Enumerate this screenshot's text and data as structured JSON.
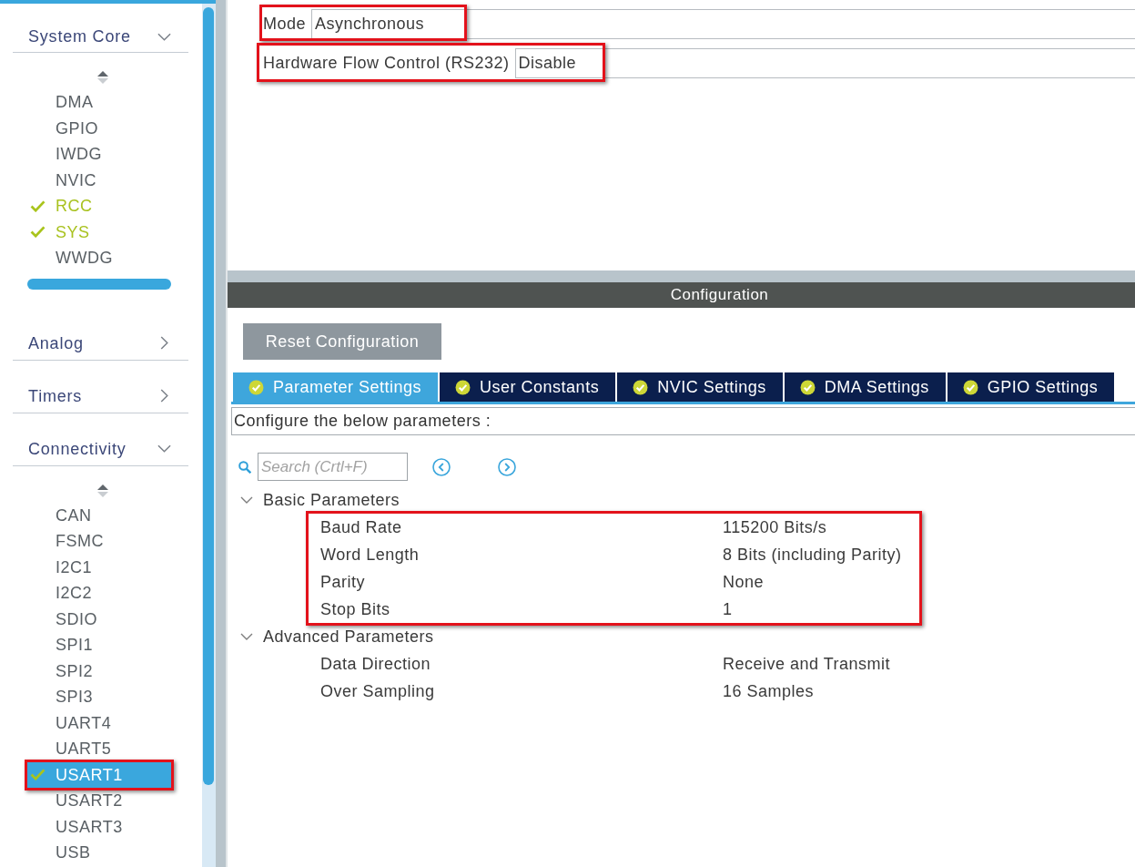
{
  "sidebar": {
    "categories": [
      {
        "title": "System Core",
        "expanded": true,
        "items": [
          {
            "label": "DMA",
            "checked": false,
            "selected": false,
            "highlighted": false
          },
          {
            "label": "GPIO",
            "checked": false,
            "selected": false,
            "highlighted": false
          },
          {
            "label": "IWDG",
            "checked": false,
            "selected": false,
            "highlighted": false
          },
          {
            "label": "NVIC",
            "checked": false,
            "selected": false,
            "highlighted": false
          },
          {
            "label": "RCC",
            "checked": true,
            "selected": false,
            "highlighted": false
          },
          {
            "label": "SYS",
            "checked": true,
            "selected": false,
            "highlighted": false
          },
          {
            "label": "WWDG",
            "checked": false,
            "selected": false,
            "highlighted": false
          }
        ]
      },
      {
        "title": "Analog",
        "expanded": false
      },
      {
        "title": "Timers",
        "expanded": false
      },
      {
        "title": "Connectivity",
        "expanded": true,
        "items": [
          {
            "label": "CAN",
            "checked": false,
            "selected": false,
            "highlighted": false
          },
          {
            "label": "FSMC",
            "checked": false,
            "selected": false,
            "highlighted": false
          },
          {
            "label": "I2C1",
            "checked": false,
            "selected": false,
            "highlighted": false
          },
          {
            "label": "I2C2",
            "checked": false,
            "selected": false,
            "highlighted": false
          },
          {
            "label": "SDIO",
            "checked": false,
            "selected": false,
            "highlighted": false
          },
          {
            "label": "SPI1",
            "checked": false,
            "selected": false,
            "highlighted": false
          },
          {
            "label": "SPI2",
            "checked": false,
            "selected": false,
            "highlighted": false
          },
          {
            "label": "SPI3",
            "checked": false,
            "selected": false,
            "highlighted": false
          },
          {
            "label": "UART4",
            "checked": false,
            "selected": false,
            "highlighted": false
          },
          {
            "label": "UART5",
            "checked": false,
            "selected": false,
            "highlighted": false
          },
          {
            "label": "USART1",
            "checked": true,
            "selected": true,
            "highlighted": true
          },
          {
            "label": "USART2",
            "checked": false,
            "selected": false,
            "highlighted": false
          },
          {
            "label": "USART3",
            "checked": false,
            "selected": false,
            "highlighted": false
          },
          {
            "label": "USB",
            "checked": false,
            "selected": false,
            "highlighted": false
          }
        ]
      }
    ]
  },
  "mode_settings": [
    {
      "label": "Mode",
      "value": "Asynchronous",
      "highlighted": true
    },
    {
      "label": "Hardware Flow Control (RS232)",
      "value": "Disable",
      "highlighted": true
    }
  ],
  "configuration": {
    "title": "Configuration",
    "reset_button": "Reset Configuration",
    "tabs": [
      {
        "label": "Parameter Settings",
        "selected": true
      },
      {
        "label": "User Constants",
        "selected": false
      },
      {
        "label": "NVIC Settings",
        "selected": false
      },
      {
        "label": "DMA Settings",
        "selected": false
      },
      {
        "label": "GPIO Settings",
        "selected": false
      }
    ],
    "description": "Configure the below parameters :",
    "search": {
      "placeholder": "Search (Crtl+F)"
    },
    "parameter_groups": [
      {
        "title": "Basic Parameters",
        "expanded": true,
        "highlighted": true,
        "parameters": [
          {
            "name": "Baud Rate",
            "value": "115200 Bits/s"
          },
          {
            "name": "Word Length",
            "value": "8 Bits (including Parity)"
          },
          {
            "name": "Parity",
            "value": "None"
          },
          {
            "name": "Stop Bits",
            "value": "1"
          }
        ]
      },
      {
        "title": "Advanced Parameters",
        "expanded": true,
        "highlighted": false,
        "parameters": [
          {
            "name": "Data Direction",
            "value": "Receive and Transmit"
          },
          {
            "name": "Over Sampling",
            "value": "16 Samples"
          }
        ]
      }
    ]
  }
}
